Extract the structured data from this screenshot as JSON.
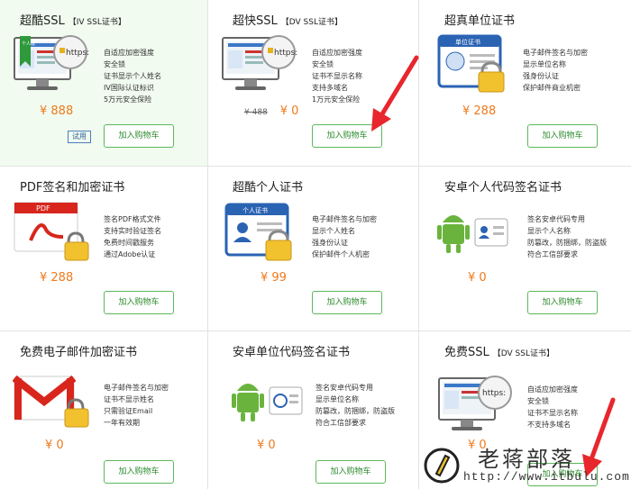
{
  "cards": [
    {
      "title": "超酷SSL",
      "tag": "【IV SSL证书】",
      "features": [
        "自适应加密强度",
        "安全锁",
        "证书显示个人姓名",
        "IV国际认证标识",
        "5万元安全保险"
      ],
      "price": "¥ 888",
      "old_price": "",
      "trial": "试用",
      "button": "加入购物车",
      "icon": "monitor-ssl-icon"
    },
    {
      "title": "超快SSL",
      "tag": "【DV SSL证书】",
      "features": [
        "自适应加密强度",
        "安全锁",
        "证书不显示名称",
        "支持多域名",
        "1万元安全保险"
      ],
      "price": "¥ 0",
      "old_price": "¥ 488",
      "trial": "",
      "button": "加入购物车",
      "icon": "monitor-ssl-icon"
    },
    {
      "title": "超真单位证书",
      "tag": "",
      "features": [
        "电子邮件签名与加密",
        "显示单位名称",
        "强身份认证",
        "保护邮件商业机密"
      ],
      "price": "¥ 288",
      "old_price": "",
      "trial": "",
      "button": "加入购物车",
      "icon": "unit-certificate-icon"
    },
    {
      "title": "PDF签名和加密证书",
      "tag": "",
      "features": [
        "签名PDF格式文件",
        "支持实时验证签名",
        "免费时间戳服务",
        "通过Adobe认证"
      ],
      "price": "¥ 288",
      "old_price": "",
      "trial": "",
      "button": "加入购物车",
      "icon": "pdf-lock-icon"
    },
    {
      "title": "超酷个人证书",
      "tag": "",
      "features": [
        "电子邮件签名与加密",
        "显示个人姓名",
        "强身份认证",
        "保护邮件个人机密"
      ],
      "price": "¥ 99",
      "old_price": "",
      "trial": "",
      "button": "加入购物车",
      "icon": "personal-certificate-icon"
    },
    {
      "title": "安卓个人代码签名证书",
      "tag": "",
      "features": [
        "签名安卓代码专用",
        "显示个人名称",
        "防篡改，防捆绑，防盗版",
        "符合工信部要求"
      ],
      "price": "¥ 0",
      "old_price": "",
      "trial": "",
      "button": "加入购物车",
      "icon": "android-person-icon"
    },
    {
      "title": "免费电子邮件加密证书",
      "tag": "",
      "features": [
        "电子邮件签名与加密",
        "证书不显示姓名",
        "只需验证Email",
        "一年有效期"
      ],
      "price": "¥ 0",
      "old_price": "",
      "trial": "",
      "button": "加入购物车",
      "icon": "gmail-lock-icon"
    },
    {
      "title": "安卓单位代码签名证书",
      "tag": "",
      "features": [
        "签名安卓代码专用",
        "显示单位名称",
        "防篡改，防捆绑，防盗版",
        "符合工信部要求"
      ],
      "price": "¥ 0",
      "old_price": "",
      "trial": "",
      "button": "加入购物车",
      "icon": "android-unit-icon"
    },
    {
      "title": "免费SSL",
      "tag": "【DV SSL证书】",
      "features": [
        "自适应加密强度",
        "安全锁",
        "证书不显示名称",
        "不支持多域名"
      ],
      "price": "¥ 0",
      "old_price": "",
      "trial": "",
      "button": "加入购物车",
      "icon": "monitor-ssl-icon"
    }
  ],
  "thumb_text": {
    "https": "https:",
    "personal": "个人版",
    "unit_cert": "单位证书",
    "personal_cert": "个人证书",
    "pdf": "PDF"
  },
  "watermark": {
    "name": "老蒋部落",
    "url": "http://www.itbulu.com"
  },
  "colors": {
    "price": "#ee7a1d",
    "button_border": "#5cb85c",
    "highlight_bg": "#f1fbef",
    "arrow": "#e8262c"
  }
}
